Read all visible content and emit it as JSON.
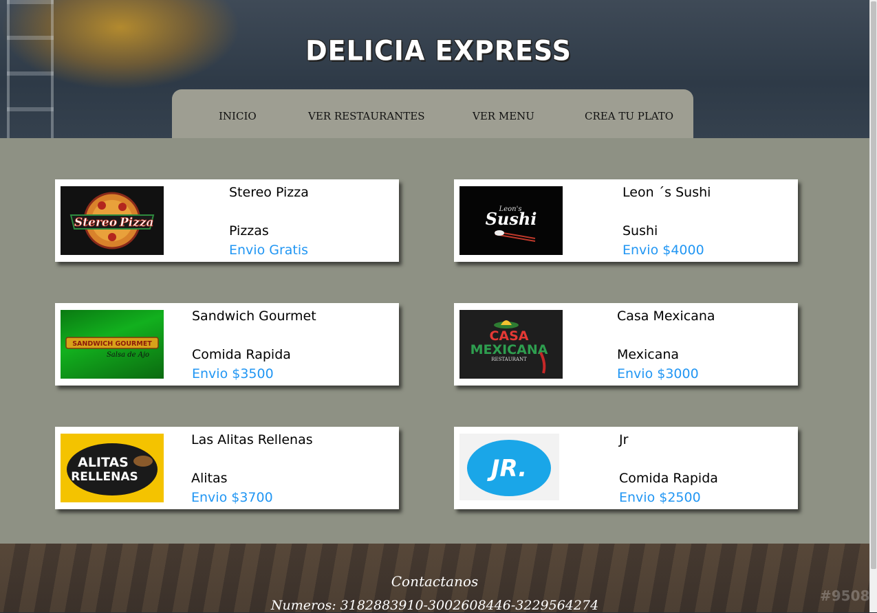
{
  "site": {
    "title": "DELICIA EXPRESS"
  },
  "nav": {
    "items": [
      {
        "label": "INICIO"
      },
      {
        "label": "VER RESTAURANTES"
      },
      {
        "label": "VER MENU"
      },
      {
        "label": "CREA TU PLATO"
      }
    ]
  },
  "restaurants": [
    {
      "name": "Stereo Pizza",
      "category": "Pizzas",
      "shipping": "Envio Gratis",
      "logo_text": [
        "Stereo",
        "Pizza"
      ]
    },
    {
      "name": "Leon ´s Sushi",
      "category": "Sushi",
      "shipping": "Envio $4000",
      "logo_text": [
        "Leon's",
        "Sushi"
      ]
    },
    {
      "name": "Sandwich Gourmet",
      "category": "Comida Rapida",
      "shipping": "Envio $3500",
      "logo_text": [
        "SANDWICH GOURMET",
        "Salsa de Ajo"
      ]
    },
    {
      "name": "Casa Mexicana",
      "category": "Mexicana",
      "shipping": "Envio $3000",
      "logo_text": [
        "CASA",
        "MEXICANA",
        "RESTAURANT"
      ]
    },
    {
      "name": "Las Alitas Rellenas",
      "category": "Alitas",
      "shipping": "Envio $3700",
      "logo_text": [
        "ALITAS",
        "RELLENAS"
      ]
    },
    {
      "name": "Jr",
      "category": "Comida Rapida",
      "shipping": "Envio $2500",
      "logo_text": [
        "JR."
      ]
    }
  ],
  "footer": {
    "title": "Contactanos",
    "phones": "Numeros: 3182883910-3002608446-3229564274"
  },
  "watermark": "#9508",
  "colors": {
    "accent": "#2196f3",
    "main_bg": "#8e9184",
    "nav_bg": "#9e9e92"
  }
}
